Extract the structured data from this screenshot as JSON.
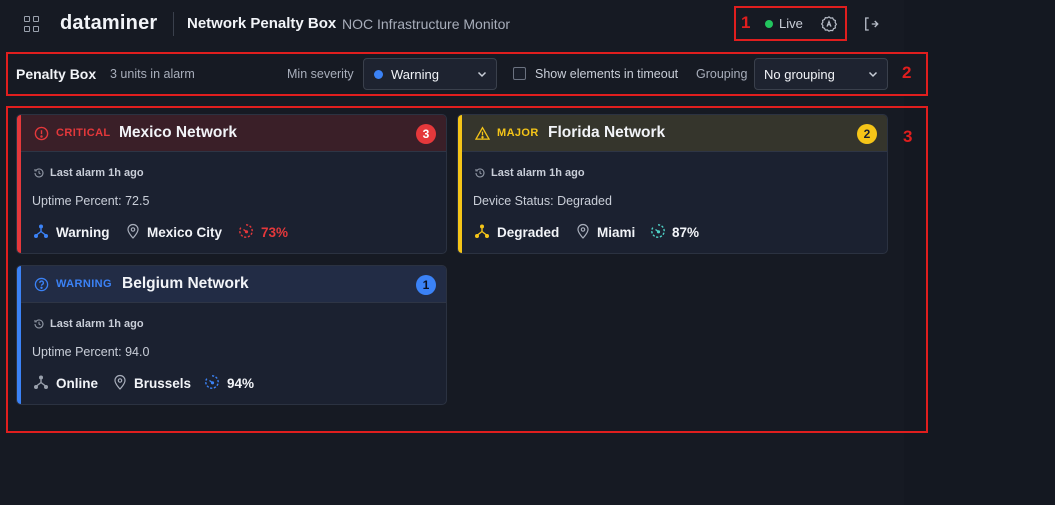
{
  "header": {
    "brand": "dataminer",
    "title": "Network Penalty Box",
    "subtitle": "NOC Infrastructure Monitor",
    "live_label": "Live"
  },
  "annotations": {
    "a1": "1",
    "a2": "2",
    "a3": "3"
  },
  "filters": {
    "title": "Penalty Box",
    "count_text": "3 units in alarm",
    "min_severity_label": "Min severity",
    "min_severity_value": "Warning",
    "timeout_label": "Show elements in timeout",
    "timeout_checked": false,
    "grouping_label": "Grouping",
    "grouping_value": "No grouping"
  },
  "cards": [
    {
      "severity": "CRITICAL",
      "name": "Mexico Network",
      "count": "3",
      "last_alarm": "Last alarm 1h ago",
      "metric": "Uptime Percent: 72.5",
      "status": "Warning",
      "location": "Mexico City",
      "percent": "73%",
      "color": "#e5383b"
    },
    {
      "severity": "MAJOR",
      "name": "Florida Network",
      "count": "2",
      "last_alarm": "Last alarm 1h ago",
      "metric": "Device Status: Degraded",
      "status": "Degraded",
      "location": "Miami",
      "percent": "87%",
      "color": "#f5c518"
    },
    {
      "severity": "WARNING",
      "name": "Belgium Network",
      "count": "1",
      "last_alarm": "Last alarm 1h ago",
      "metric": "Uptime Percent: 94.0",
      "status": "Online",
      "location": "Brussels",
      "percent": "94%",
      "color": "#3b82f6"
    }
  ]
}
